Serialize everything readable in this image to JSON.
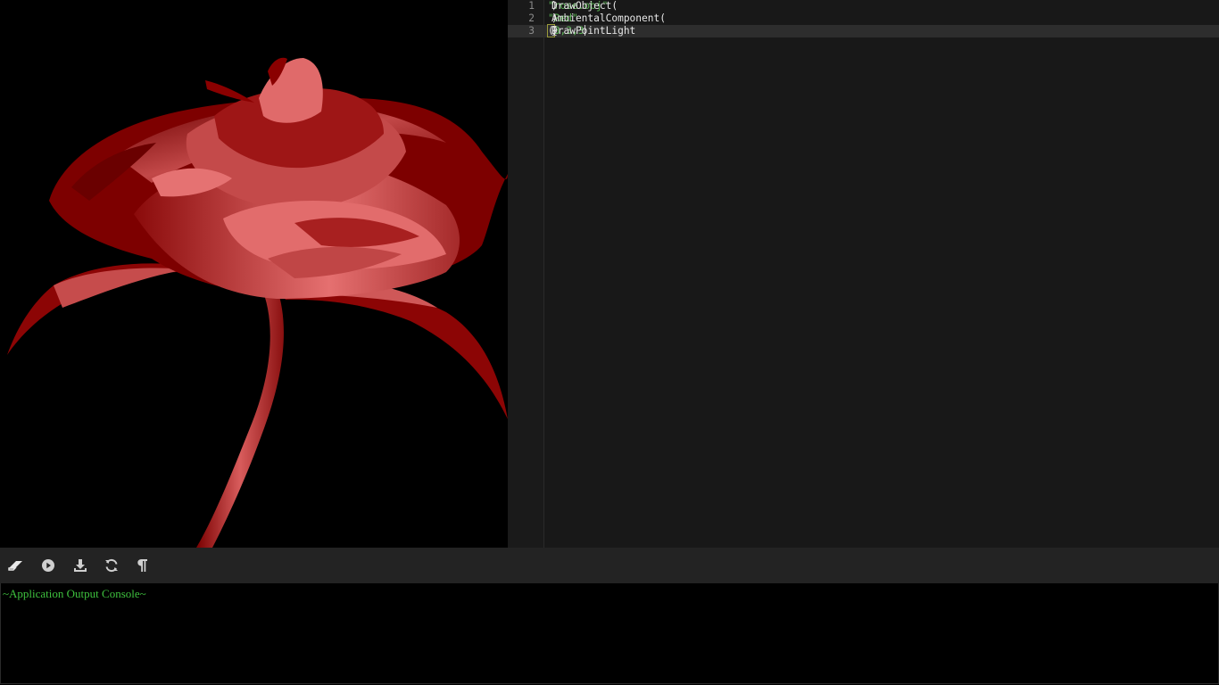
{
  "editor": {
    "lines": [
      {
        "num": "1",
        "parts": [
          {
            "t": "DrawObject(",
            "c": "txt"
          },
          {
            "t": "\"rose.obj\"",
            "c": "str"
          },
          {
            "t": ")",
            "c": "txt"
          }
        ]
      },
      {
        "num": "2",
        "parts": [
          {
            "t": "AmbientalComponent(",
            "c": "txt"
          },
          {
            "t": "\"Red\"",
            "c": "str"
          },
          {
            "t": ")",
            "c": "txt"
          }
        ]
      },
      {
        "num": "3",
        "parts": [
          {
            "t": "DrawPointLight",
            "c": "txt"
          },
          {
            "t": "(",
            "c": "brk-match"
          },
          {
            "t": "{",
            "c": "txt"
          },
          {
            "t": "3,3,3",
            "c": "num"
          },
          {
            "t": "}",
            "c": "txt"
          },
          {
            "t": ")",
            "c": "txt"
          }
        ],
        "active": true
      }
    ]
  },
  "toolbar": {
    "buttons": [
      {
        "name": "eraser-icon",
        "title": "Clear"
      },
      {
        "name": "play-icon",
        "title": "Run"
      },
      {
        "name": "download-icon",
        "title": "Save"
      },
      {
        "name": "refresh-icon",
        "title": "Reload"
      },
      {
        "name": "pilcrow-icon",
        "title": "Format"
      }
    ]
  },
  "console": {
    "header": "~Application Output Console~"
  },
  "colors": {
    "console_text": "#3ec13e",
    "rose_dark": "#7a0000",
    "rose_light": "#e06464",
    "string": "#59b553"
  }
}
